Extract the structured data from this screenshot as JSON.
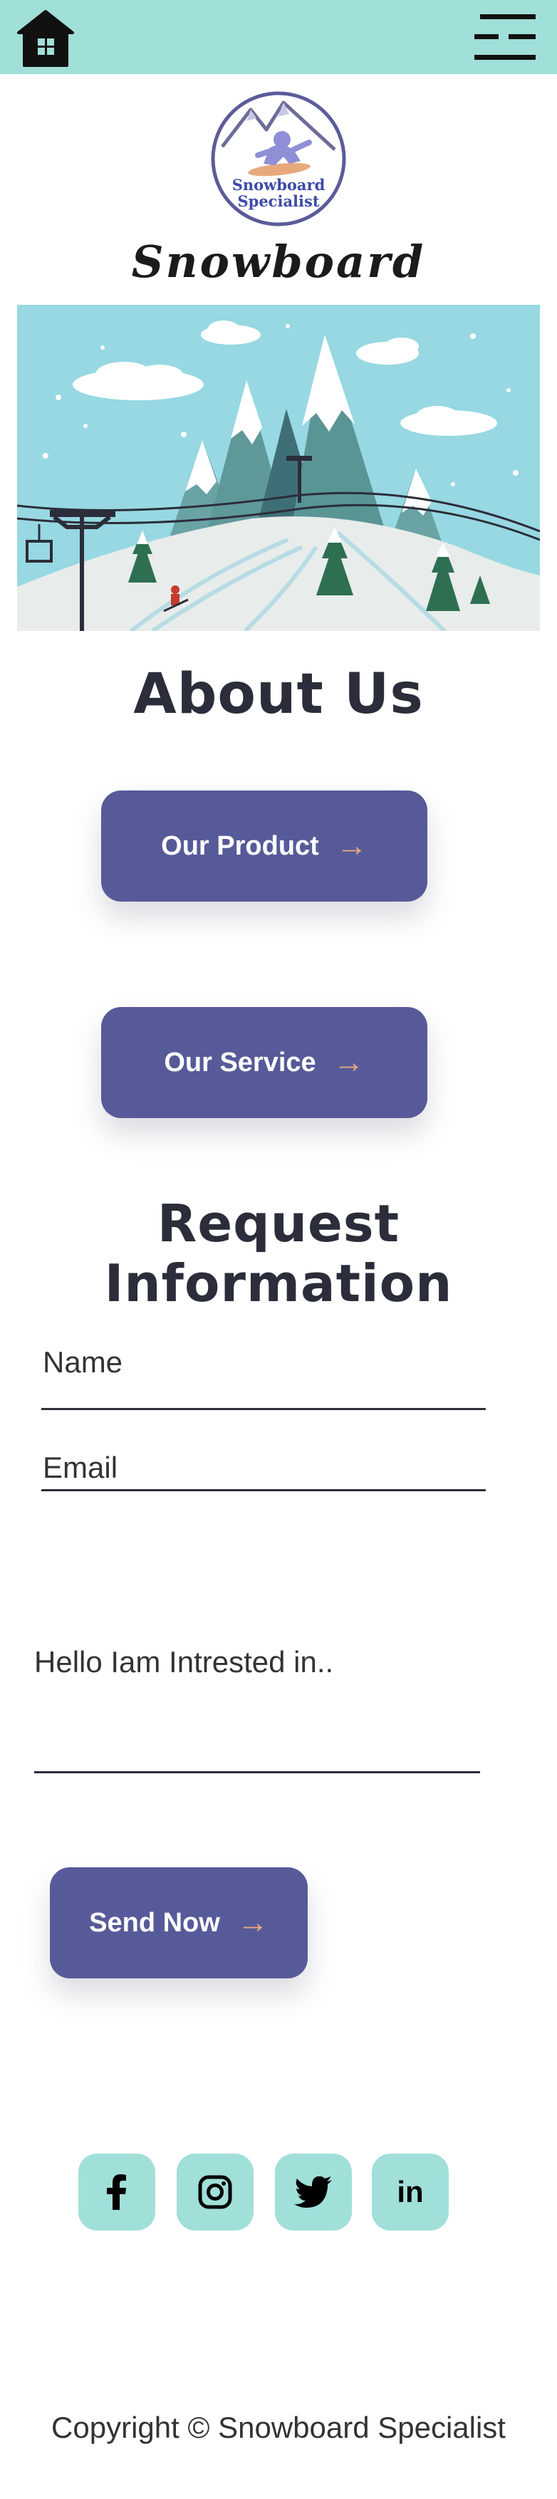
{
  "header": {
    "home_icon": "home-icon",
    "menu_icon": "menu-icon"
  },
  "logo": {
    "line1": "Snowboard",
    "line2": "Specialist"
  },
  "brand": "Snowboard Specialist",
  "about": {
    "title": "About Us",
    "product_label": "Our Product",
    "service_label": "Our Service",
    "arrow": "→"
  },
  "request": {
    "title": "Request Information",
    "name_placeholder": "Name",
    "email_placeholder": "Email",
    "message_placeholder": "Hello Iam Intrested in..",
    "send_label": "Send Now"
  },
  "socials": {
    "linkedin_label": "in",
    "icons": [
      "facebook-icon",
      "instagram-icon",
      "twitter-icon",
      "linkedin-icon"
    ]
  },
  "footer": {
    "copyright": "Copyright © Snowboard Specialist"
  },
  "colors": {
    "accent": "#a1dfd9",
    "button": "#575a99",
    "arrow": "#e7a97c",
    "text": "#2b2d3a"
  }
}
